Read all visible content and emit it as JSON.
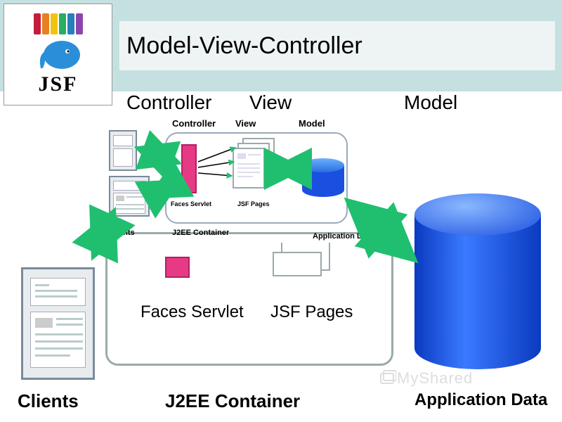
{
  "header": {
    "title": "Model-View-Controller",
    "logo_text": "JSF",
    "logo_colors": [
      "#c41e3a",
      "#e67e22",
      "#f1c40f",
      "#27ae60",
      "#2980b9",
      "#8e44ad"
    ]
  },
  "diagram": {
    "section_labels": {
      "controller": "Controller",
      "view": "View",
      "model": "Model"
    },
    "inner_labels": {
      "controller": "Controller",
      "view": "View",
      "model": "Model",
      "faces_servlet": "Faces Servlet",
      "jsf_pages": "JSF Pages",
      "clients": "Clients",
      "j2ee_container": "J2EE Container",
      "application_data": "Application Data"
    },
    "bottom_labels": {
      "clients": "Clients",
      "faces_servlet": "Faces Servlet",
      "jsf_pages": "JSF Pages",
      "j2ee_container": "J2EE Container",
      "application_data": "Application Data"
    }
  },
  "watermark": "MyShared"
}
